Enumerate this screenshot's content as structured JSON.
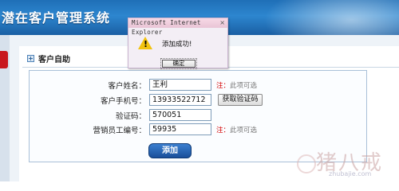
{
  "header": {
    "title": "潜在客户管理系统"
  },
  "section": {
    "title": "客户自助",
    "icon": "plus-box-icon"
  },
  "form": {
    "fields": [
      {
        "label": "客户姓名：",
        "value": "王利",
        "note_req": "注：",
        "note": "此项可选"
      },
      {
        "label": "客户手机号：",
        "value": "13933522712",
        "button": "获取验证码"
      },
      {
        "label": "验证码：",
        "value": "570051"
      },
      {
        "label": "营销员工编号：",
        "value": "59935",
        "note_req": "注：",
        "note": "此项可选"
      }
    ],
    "submit_label": "添加"
  },
  "dialog": {
    "title": "Microsoft Internet Explorer",
    "close_glyph": "×",
    "icon": "warning-icon",
    "message": "添加成功!",
    "ok_label": "确定"
  },
  "watermark": {
    "text": "猪八戒",
    "url": "zhubajie.com"
  },
  "colors": {
    "banner": "#2d86cf",
    "accent_red": "#c8161d",
    "note_required": "#d40000"
  }
}
